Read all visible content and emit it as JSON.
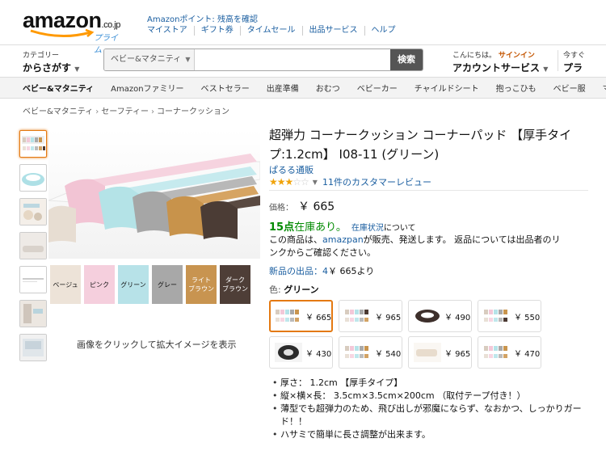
{
  "header": {
    "logo_word": "amazon",
    "logo_suffix": ".co.jp",
    "logo_prime": "プライム",
    "points_line": "Amazonポイント: 残高を確認",
    "links": [
      "マイストア",
      "ギフト券",
      "タイムセール",
      "出品サービス",
      "ヘルプ"
    ],
    "category_label": "カテゴリー",
    "category_value": "からさがす",
    "search_scope": "ベビー&マタニティ",
    "search_value": "",
    "search_button": "検索",
    "greeting": "こんにちは。",
    "signin": "サインイン",
    "account_services": "アカウントサービス",
    "more_line1": "今すぐ",
    "more_line2": "プラ"
  },
  "nav": {
    "items": [
      "ベビー&マタニティ",
      "Amazonファミリー",
      "ベストセラー",
      "出産準備",
      "おむつ",
      "ベビーカー",
      "チャイルドシート",
      "抱っこひも",
      "ベビー服",
      "マタ"
    ]
  },
  "breadcrumb": [
    "ベビー&マタニティ",
    "セーフティー",
    "コーナークッション"
  ],
  "gallery": {
    "swatch_labels": [
      "ベージュ",
      "ピンク",
      "グリーン",
      "グレー",
      "ライト\nブラウン",
      "ダーク\nブラウン"
    ],
    "click_message": "画像をクリックして拡大イメージを表示"
  },
  "product": {
    "title": "超弾力 コーナークッション コーナーパッド 【厚手タイプ:1.2cm】 I08-11 (グリーン)",
    "brand": "ぱるる通販",
    "rating_stars": 3,
    "reviews_link": "11件のカスタマーレビュー",
    "price_label": "価格：",
    "price": "￥ 665",
    "stock_strong": "15点",
    "stock_text": "在庫あり。",
    "stock_link": "在庫状況",
    "stock_after": "について",
    "seller_before": "この商品は、",
    "seller_name": "amazpan",
    "seller_after": "が販売、発送します。 返品については出品者のリンクからご確認ください。",
    "new_offers_link": "新品の出品：4",
    "new_offers_price": "￥ 665より",
    "color_label": "色: ",
    "color_value": "グリーン",
    "variants": [
      {
        "price": "￥ 665",
        "selected": true
      },
      {
        "price": "￥ 965",
        "selected": false
      },
      {
        "price": "￥ 490",
        "selected": false
      },
      {
        "price": "￥ 550",
        "selected": false
      },
      {
        "price": "￥ 430",
        "selected": false
      },
      {
        "price": "￥ 540",
        "selected": false
      },
      {
        "price": "￥ 965",
        "selected": false
      },
      {
        "price": "￥ 470",
        "selected": false
      }
    ],
    "bullets": [
      "厚さ： 1.2cm 【厚手タイプ】",
      "縦×横×長： 3.5cm×3.5cm×200cm （取付テープ付き！）",
      "薄型でも超弾力のため、飛び出しが邪魔にならず、なおかつ、しっかりガード！！",
      "ハサミで簡単に長さ調整が出来ます。"
    ]
  },
  "colors": {
    "link": "#1a5ea0",
    "in_stock": "#008a00",
    "accent": "#e47911",
    "star": "#f0a30a"
  }
}
